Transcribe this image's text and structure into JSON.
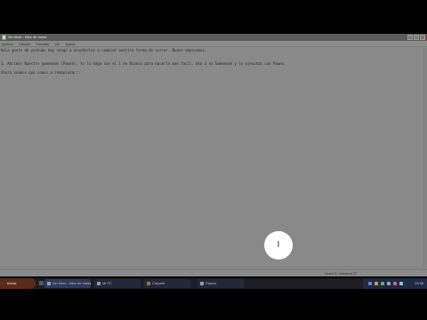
{
  "window": {
    "title": "Sin título - Bloc de notas",
    "menu": [
      "Archivo",
      "Edición",
      "Formato",
      "Ver",
      "Ayuda"
    ]
  },
  "editor": {
    "lines": [
      "Hola gente de youtube hoy vengo a enseñarles a cambiar nuestra forma de correr. Bueno empecemos.",
      "",
      "1. Abrimos Nuestro gamemode (Pawno), Yo lo haga con el 1 en Blanco para hacerlo mas facil. Uso a su Gamemode y lo ejecutas con Pawno.",
      "",
      "Ahora veamos que vamos a reemplazar::"
    ]
  },
  "status": {
    "position": "Línea 5, columna 37"
  },
  "taskbar": {
    "start_label": "inicio",
    "tasks": [
      {
        "label": "Sin título - Bloc de notas",
        "active": true,
        "icon": "notepad-icon"
      },
      {
        "label": "Mi PC",
        "active": false,
        "icon": "computer-icon"
      },
      {
        "label": "Carpeta",
        "active": false,
        "icon": "folder-icon"
      },
      {
        "label": "Pawno",
        "active": false,
        "icon": "pawno-icon"
      }
    ],
    "clock": "13:35"
  },
  "colors": {
    "window_bg": "#8a8a8a",
    "taskbar_bg": "#1e1e24",
    "start_bg": "#5a2a1a",
    "cursor_highlight": "#ffffff"
  }
}
